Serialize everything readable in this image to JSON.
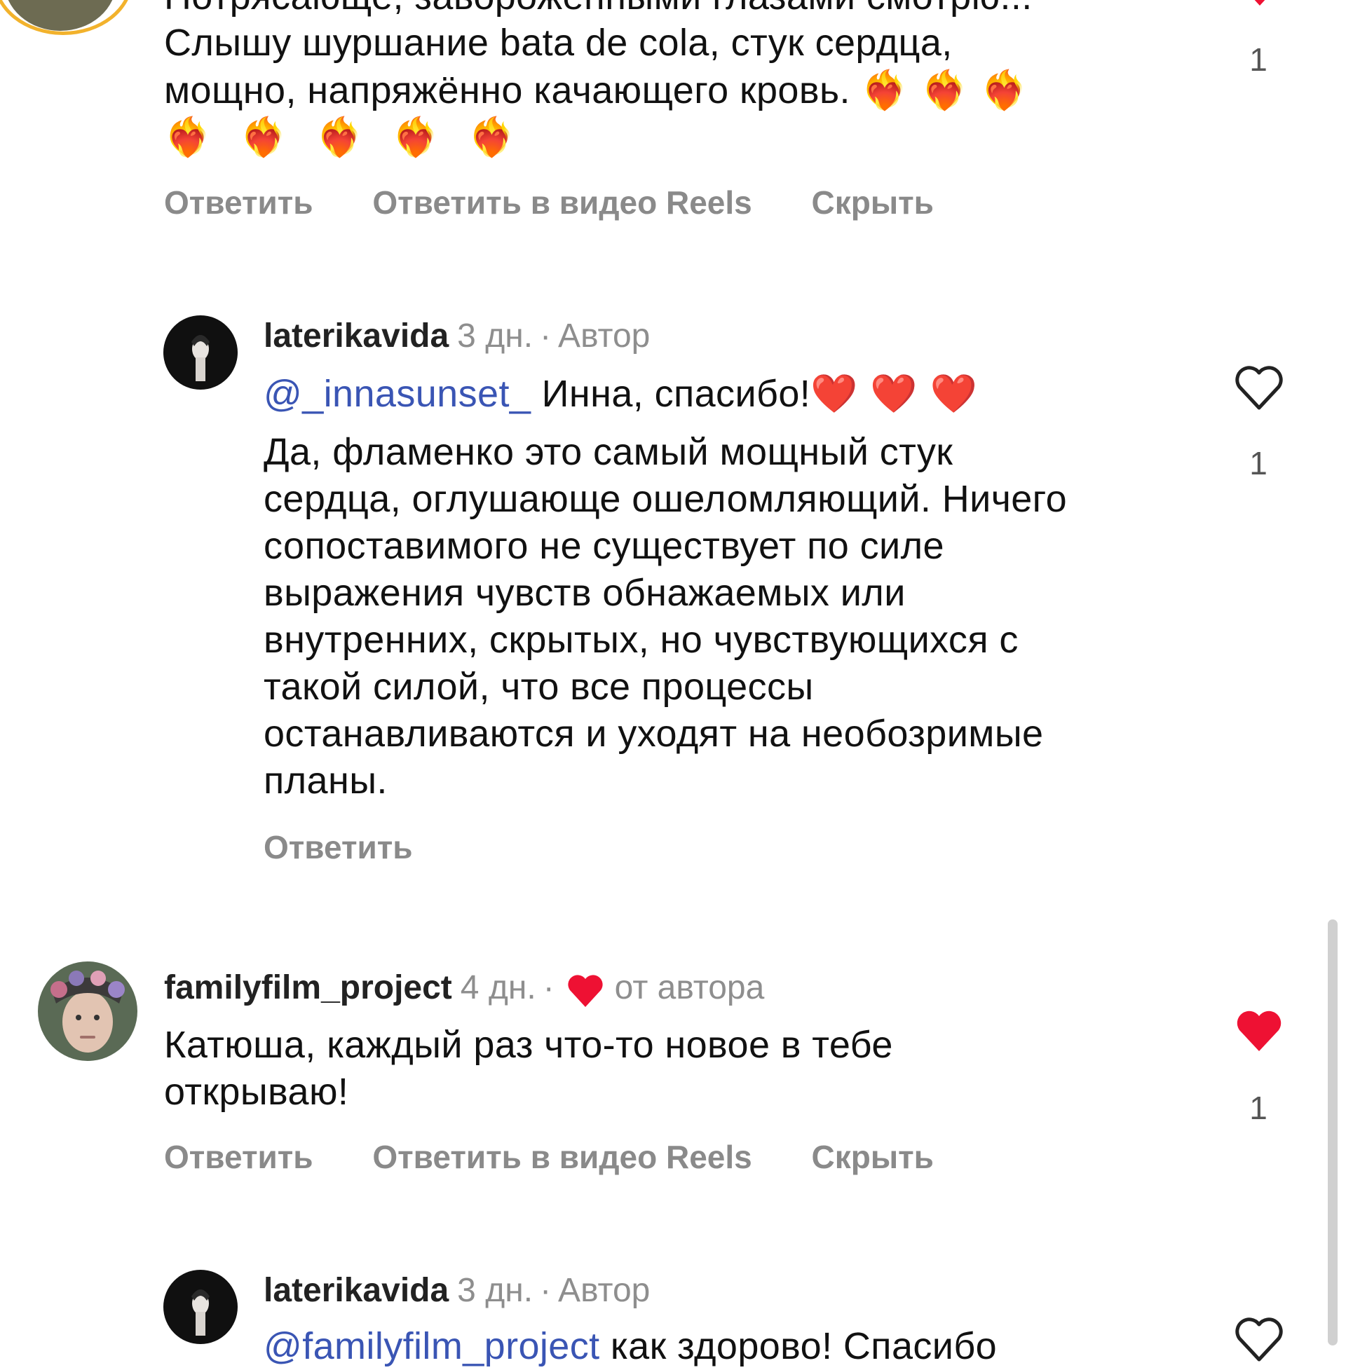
{
  "comment1": {
    "text_line1_partial": "Потрясающе, завороженными глазами смотрю...",
    "text_line2": "Слышу шуршание bata de cola, стук сердца,",
    "text_line3": "мощно, напряжённо качающего кровь.",
    "emoji_inline": "❤️‍🔥 ❤️‍🔥 ❤️‍🔥",
    "emoji_line": "❤️‍🔥 ❤️‍🔥 ❤️‍🔥 ❤️‍🔥 ❤️‍🔥",
    "like_count": "1",
    "actions": {
      "reply": "Ответить",
      "reply_reels": "Ответить в видео Reels",
      "hide": "Скрыть"
    }
  },
  "reply1": {
    "username": "laterikavida",
    "time": "3 дн.",
    "separator": "·",
    "role": "Автор",
    "mention": "@_innasunset_",
    "first_line": " Инна, спасибо!",
    "emoji": "❤️ ❤️ ❤️",
    "body_lines": [
      "Да, фламенко это самый мощный стук",
      "сердца, оглушающе ошеломляющий. Ничего",
      "сопоставимого не существует по силе",
      "выражения чувств обнажаемых или",
      "внутренних, скрытых, но чувствующихся с",
      "такой силой, что все процессы",
      "останавливаются и уходят на необозримые",
      "планы."
    ],
    "like_count": "1",
    "action_reply": "Ответить"
  },
  "comment2": {
    "username": "familyfilm_project",
    "time": "4 дн.",
    "separator": "·",
    "liked_by_author": "от автора",
    "text_line1": "Катюша, каждый раз что-то новое в тебе",
    "text_line2": "открываю!",
    "like_count": "1",
    "actions": {
      "reply": "Ответить",
      "reply_reels": "Ответить в видео Reels",
      "hide": "Скрыть"
    }
  },
  "reply2": {
    "username": "laterikavida",
    "time": "3 дн.",
    "separator": "·",
    "role": "Автор",
    "mention_partial": "@familyfilm_project",
    "text_partial": " как здорово! Спасибо"
  },
  "colors": {
    "heart_red": "#ee1133",
    "mention_blue": "#3a55b4",
    "action_gray": "#8a8a8a"
  }
}
